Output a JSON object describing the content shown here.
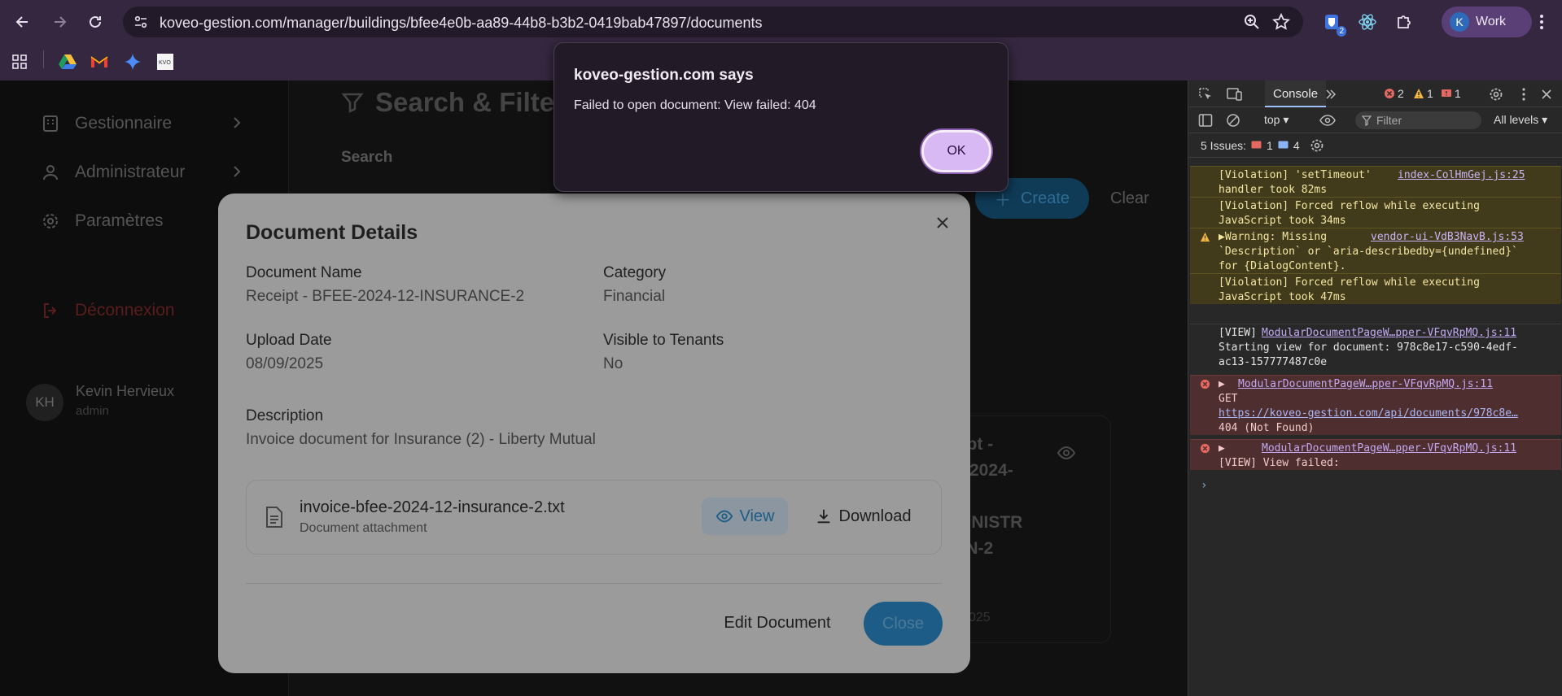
{
  "browser": {
    "url": "koveo-gestion.com/manager/buildings/bfee4e0b-aa89-44b8-b3b2-0419bab47897/documents",
    "profile_label": "Work",
    "profile_initial": "K",
    "extension_badge": "2"
  },
  "sidebar": {
    "items": [
      {
        "label": "Gestionnaire",
        "icon": "building-icon"
      },
      {
        "label": "Administrateur",
        "icon": "user-icon"
      },
      {
        "label": "Paramètres",
        "icon": "gear-icon"
      }
    ],
    "logout_label": "Déconnexion",
    "user_name": "Kevin Hervieux",
    "user_role": "admin",
    "user_initials": "KH"
  },
  "background": {
    "heading": "Search & Filter",
    "search_label": "Search",
    "create_label": "Create",
    "clear_label": "Clear",
    "card_lines": [
      "eipt -",
      "E-2024-",
      "MINISTR",
      "ON-2"
    ],
    "card_date": "025"
  },
  "modal": {
    "title": "Document Details",
    "fields": {
      "document_name": {
        "label": "Document Name",
        "value": "Receipt - BFEE-2024-12-INSURANCE-2"
      },
      "category": {
        "label": "Category",
        "value": "Financial"
      },
      "upload_date": {
        "label": "Upload Date",
        "value": "08/09/2025"
      },
      "visible_to_tenants": {
        "label": "Visible to Tenants",
        "value": "No"
      },
      "description": {
        "label": "Description",
        "value": "Invoice document for Insurance (2) - Liberty Mutual"
      }
    },
    "attachment": {
      "file_name": "invoice-bfee-2024-12-insurance-2.txt",
      "subtitle": "Document attachment",
      "view_label": "View",
      "download_label": "Download"
    },
    "edit_label": "Edit Document",
    "close_label": "Close"
  },
  "alert": {
    "title": "koveo-gestion.com says",
    "message": "Failed to open document: View failed: 404",
    "ok_label": "OK"
  },
  "devtools": {
    "active_tab": "Console",
    "error_count": "2",
    "warning_count": "1",
    "issue_count_badge": "1",
    "context": "top",
    "filter_placeholder": "Filter",
    "levels": "All levels",
    "issues_label": "5 Issues:",
    "issues_errors": "1",
    "issues_info": "4",
    "logs": [
      {
        "type": "warn",
        "text": "[Violation] 'setTimeout'\nhandler took 82ms",
        "source": "index-ColHmGej.js:25"
      },
      {
        "type": "warn",
        "text": "[Violation] Forced reflow while executing\nJavaScript took 34ms",
        "source": ""
      },
      {
        "type": "warn",
        "text": "▶Warning: Missing\n`Description` or `aria-describedby={undefined}`\nfor {DialogContent}.",
        "source": "vendor-ui-VdB3NavB.js:53"
      },
      {
        "type": "warn",
        "text": "[Violation] Forced reflow while executing\nJavaScript took 47ms",
        "source": ""
      },
      {
        "type": "info",
        "text": "[VIEW]\nStarting view for document: 978c8e17-c590-4edf-\nac13-157777487c0e",
        "source": "ModularDocumentPageW…pper-VFqvRpMQ.js:11"
      },
      {
        "type": "err",
        "text": "▶\nGET\nhttps://koveo-gestion.com/api/documents/978c8e…\n404 (Not Found)",
        "source": "ModularDocumentPageW…pper-VFqvRpMQ.js:11"
      },
      {
        "type": "err",
        "text": "▶\n[VIEW] View failed:",
        "source": "ModularDocumentPageW…pper-VFqvRpMQ.js:11"
      }
    ]
  }
}
